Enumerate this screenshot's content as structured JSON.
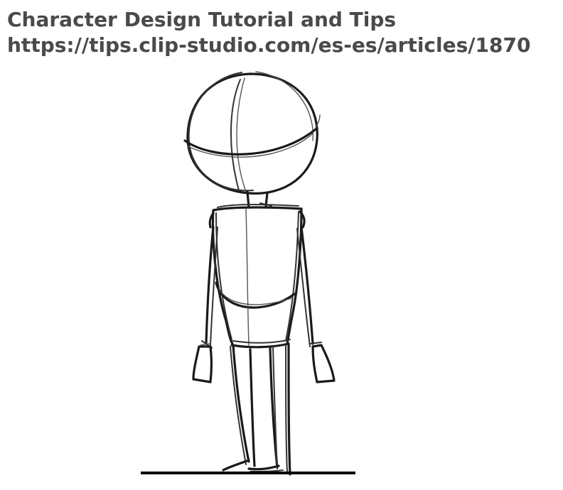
{
  "caption": {
    "title": "Character Design Tutorial and Tips",
    "url": "https://tips.clip-studio.com/es-es/articles/1870"
  },
  "colors": {
    "caption_text": "#4a4a4a",
    "line_art": "#1a1a1a",
    "background": "#ffffff"
  }
}
